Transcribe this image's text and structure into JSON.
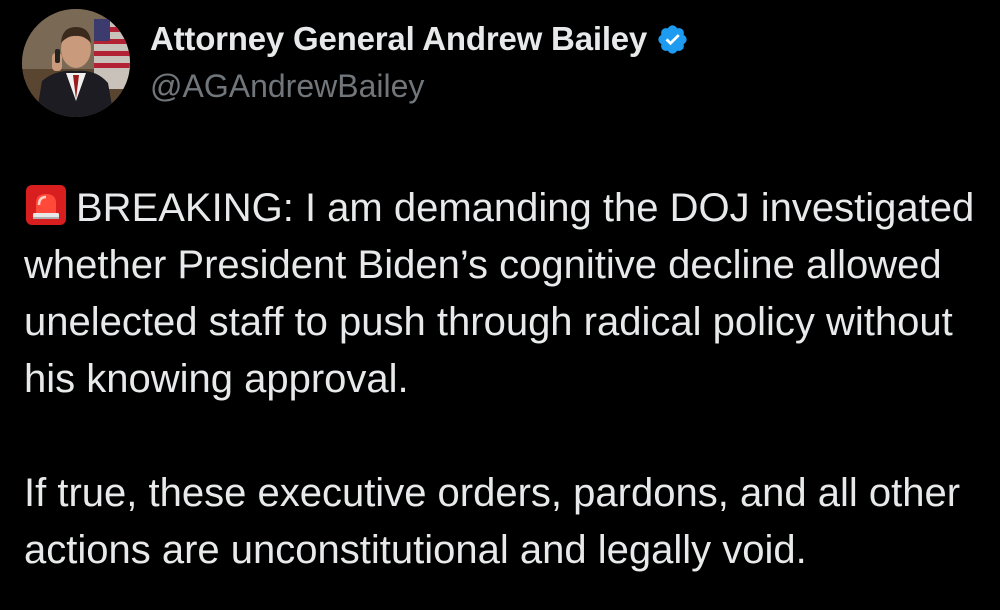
{
  "author": {
    "display_name": "Attorney General Andrew Bailey",
    "handle": "@AGAndrewBailey",
    "verified_icon": "verified-badge-icon",
    "avatar_icon": "profile-photo",
    "verified_color": "#1d9bf0"
  },
  "tweet": {
    "lead_icon": "rotating-light-siren-icon",
    "paragraph_1": "BREAKING: I am demanding the DOJ investigated whether President Biden’s cognitive decline allowed unelected staff to push through radical policy without his knowing approval.",
    "paragraph_2": "If true, these executive orders, pardons, and all other actions are unconstitutional and legally void."
  },
  "colors": {
    "background": "#000000",
    "text_primary": "#e7e9ea",
    "text_secondary": "#71767b"
  }
}
